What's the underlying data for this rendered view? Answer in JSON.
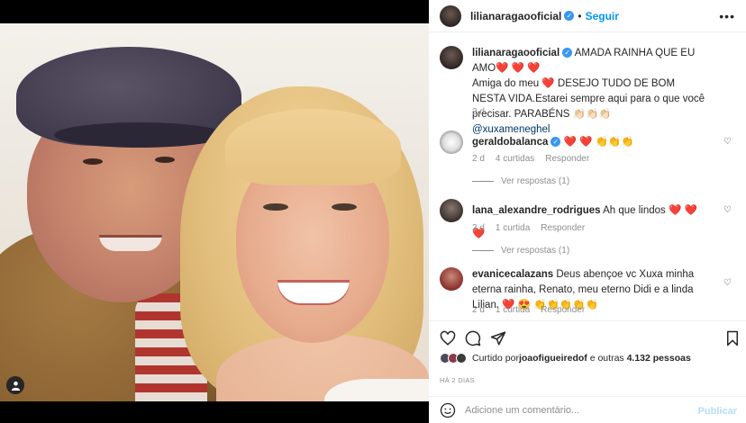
{
  "media": {
    "alt": "",
    "user_tag_icon": "user-icon"
  },
  "post": {
    "author": "lilianaragaooficial",
    "follow_separator": "•",
    "follow_label": "Seguir",
    "more_label": "•••",
    "caption_author": "lilianaragaooficial",
    "caption_line1": " AMADA RAINHA QUE EU AMO",
    "caption_hearts1": "❤️ ❤️ ❤️",
    "caption_line2a": "Amiga do meu ",
    "caption_heart2": "❤️",
    "caption_line2b": " DESEJO TUDO DE BOM NESTA VIDA.Estarei sempre aqui para o que você precisar. PARABÉNS 👏🏻👏🏻👏🏻",
    "caption_mention": "@xuxameneghel",
    "caption_time": "2 d"
  },
  "comments": [
    {
      "user": "geraldobalanca",
      "verified": true,
      "text_hearts": "❤️ ❤️",
      "text_rest": " 👏👏👏",
      "time": "2 d",
      "likes": "4 curtidas",
      "reply": "Responder",
      "view_replies": "Ver respostas (1)"
    },
    {
      "user": "lana_alexandre_rodrigues",
      "text": " Ah que lindos ",
      "text_hearts": "❤️ ❤️ ❤️",
      "time": "2 d",
      "likes": "1 curtida",
      "reply": "Responder",
      "view_replies": "Ver respostas (1)"
    },
    {
      "user": "evanicecalazans",
      "text": " Deus abençoe vc Xuxa minha eterna rainha, Renato, meu eterno Didi e a linda Lilian. ",
      "text_hearts": "❤️ 😍",
      "text_rest": " 👏👏👏👏👏",
      "time": "2 d",
      "likes": "1 curtida",
      "reply": "Responder"
    }
  ],
  "actions": {
    "like_icon": "heart-icon",
    "comment_icon": "comment-icon",
    "share_icon": "share-icon",
    "save_icon": "bookmark-icon"
  },
  "likes_summary": {
    "prefix": "Curtido por ",
    "user": "joaofigueiredof",
    "suffix": " e outras ",
    "count": "4.132 pessoas"
  },
  "date": "HÁ 2 DIAS",
  "add_comment": {
    "placeholder": "Adicione um comentário...",
    "publish_label": "Publicar",
    "emoji_icon": "smiley-icon"
  },
  "colors": {
    "link_blue": "#0095f6",
    "heart_red": "#ed4956",
    "muted_gray": "#8e8e8e",
    "publish_disabled": "#b2dffc"
  }
}
